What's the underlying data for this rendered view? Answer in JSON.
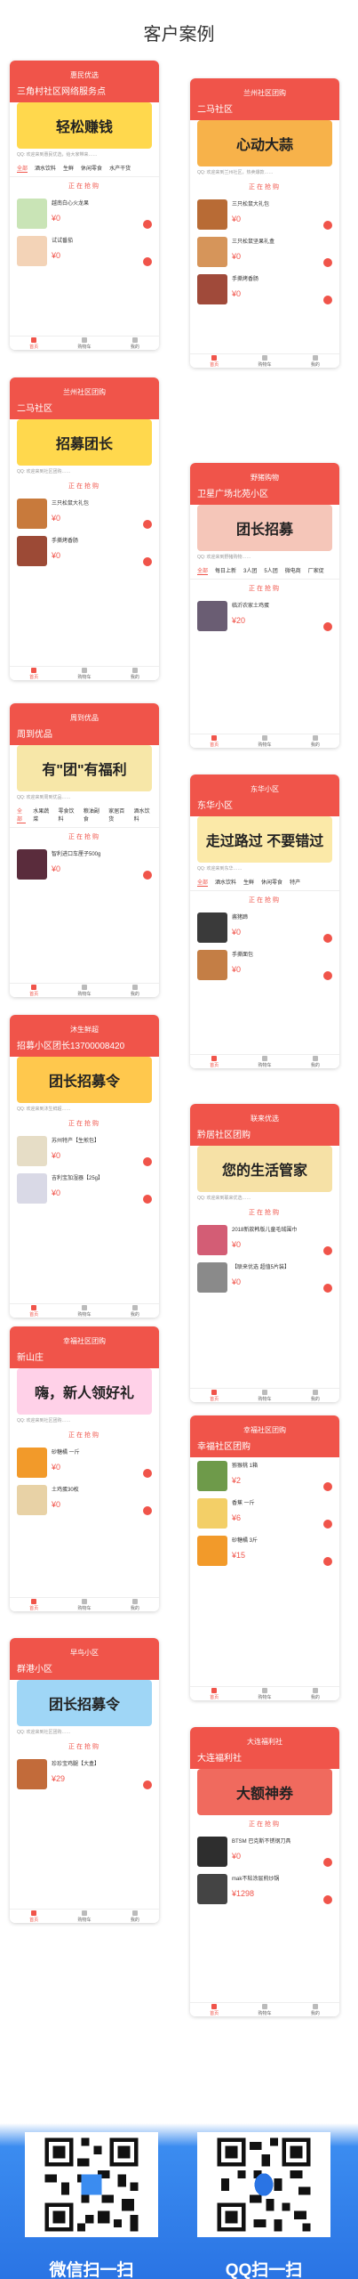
{
  "page": {
    "title": "客户案例"
  },
  "phones": [
    {
      "id": "p1",
      "header": "惠民优选",
      "location": "三角村社区网络服务点",
      "banner": "轻松赚钱",
      "bannerColor": "#ffd84d",
      "notice": "QQ: 欢迎来到惠民优选，给大家带来……",
      "tabs": [
        "全部",
        "酒水饮料",
        "生鲜",
        "休闲零食",
        "水产干货"
      ],
      "section": "正在抢购",
      "products": [
        {
          "name": "越南白心火龙果",
          "price": "¥0",
          "thumb": "#c9e4b6"
        },
        {
          "name": "试试番茄",
          "price": "¥0",
          "thumb": "#f3d3b7"
        }
      ],
      "nav": [
        "首页",
        "购物车",
        "我的"
      ]
    },
    {
      "id": "p2",
      "header": "兰州社区团购",
      "location": "二马社区",
      "banner": "心动大蒜",
      "bannerColor": "#f7b24a",
      "notice": "QQ: 欢迎来到兰州社区，热卖爆款……",
      "tabs": [],
      "section": "正在抢购",
      "products": [
        {
          "name": "三只松鼠大礼包",
          "price": "¥0",
          "thumb": "#b86b35"
        },
        {
          "name": "三只松鼠坚果礼盒",
          "price": "¥0",
          "thumb": "#d6955a"
        },
        {
          "name": "手撕烤香肠",
          "price": "¥0",
          "thumb": "#a04a3a"
        }
      ],
      "nav": [
        "首页",
        "购物车",
        "我的"
      ]
    },
    {
      "id": "p3",
      "header": "兰州社区团购",
      "location": "二马社区",
      "banner": "招募团长",
      "bannerColor": "#ffd84d",
      "notice": "QQ: 欢迎来到社区团购……",
      "tabs": [],
      "section": "正在抢购",
      "products": [
        {
          "name": "三只松鼠大礼包",
          "price": "¥0",
          "thumb": "#c87a3c"
        },
        {
          "name": "手撕烤香肠",
          "price": "¥0",
          "thumb": "#9c4a36"
        }
      ],
      "nav": [
        "首页",
        "购物车",
        "我的"
      ]
    },
    {
      "id": "p4",
      "header": "野猪购物",
      "location": "卫星广场北苑小区",
      "banner": "团长招募",
      "bannerColor": "#f5c6b9",
      "notice": "QQ: 欢迎来到野猪购物……",
      "tabs": [
        "全部",
        "每日上新",
        "3人团",
        "5人团",
        "微电商",
        "厂家促"
      ],
      "section": "正在抢购",
      "products": [
        {
          "name": "临沂农家土鸡蛋",
          "price": "¥20",
          "thumb": "#6a5d73"
        }
      ],
      "nav": [
        "首页",
        "购物车",
        "我的"
      ]
    },
    {
      "id": "p5",
      "header": "周到优品",
      "location": "周到优品",
      "banner": "有\"团\"有福利",
      "bannerColor": "#f7e7a8",
      "notice": "QQ: 欢迎来到周到优品……",
      "tabs": [
        "全部",
        "水果蔬菜",
        "零食饮料",
        "粮油副食",
        "家居百货",
        "酒水饮料"
      ],
      "section": "正在抢购",
      "products": [
        {
          "name": "智利进口车厘子500g",
          "price": "¥0",
          "thumb": "#5a2c3c"
        }
      ],
      "nav": [
        "首页",
        "购物车",
        "我的"
      ]
    },
    {
      "id": "p6",
      "header": "东华小区",
      "location": "东华小区",
      "banner": "走过路过 不要错过",
      "bannerColor": "#fbe9a8",
      "notice": "QQ: 欢迎来到东华……",
      "tabs": [
        "全部",
        "酒水饮料",
        "生鲜",
        "休闲零食",
        "特产"
      ],
      "section": "正在抢购",
      "products": [
        {
          "name": "酱猪蹄",
          "price": "¥0",
          "thumb": "#3a3a3a"
        },
        {
          "name": "手撕面包",
          "price": "¥0",
          "thumb": "#c47e45"
        }
      ],
      "nav": [
        "首页",
        "购物车",
        "我的"
      ]
    },
    {
      "id": "p7",
      "header": "沐生鲜超",
      "location": "招募小区团长13700008420",
      "banner": "团长招募令",
      "bannerColor": "#ffc84d",
      "notice": "QQ: 欢迎来到沐生鲜超……",
      "tabs": [],
      "section": "正在抢购",
      "products": [
        {
          "name": "苏州特产【生煎包】",
          "price": "¥0",
          "thumb": "#e6ddc6"
        },
        {
          "name": "吉利宝加湿器【25g】",
          "price": "¥0",
          "thumb": "#d9d9e6"
        }
      ],
      "nav": [
        "首页",
        "购物车",
        "我的"
      ]
    },
    {
      "id": "p8",
      "header": "联来优选",
      "location": "黔居社区团购",
      "banner": "您的生活管家",
      "bannerColor": "#f6e1a6",
      "notice": "QQ: 欢迎来到联来优选……",
      "tabs": [],
      "section": "正在抢购",
      "products": [
        {
          "name": "2018新款韩版儿童毛绒围巾",
          "price": "¥0",
          "thumb": "#d35d75"
        },
        {
          "name": "【联来优选 超值5片装】",
          "price": "¥0",
          "thumb": "#8a8a8a"
        }
      ],
      "nav": [
        "首页",
        "购物车",
        "我的"
      ]
    },
    {
      "id": "p9",
      "header": "幸福社区团购",
      "location": "新山庄",
      "banner": "嗨，新人领好礼",
      "bannerColor": "#ffd1e8",
      "notice": "QQ: 欢迎来到社区团购……",
      "tabs": [],
      "section": "正在抢购",
      "products": [
        {
          "name": "砂糖橘 一斤",
          "price": "¥0",
          "thumb": "#f29a2a"
        },
        {
          "name": "土鸡蛋30枚",
          "price": "¥0",
          "thumb": "#e8d2a6"
        }
      ],
      "nav": [
        "首页",
        "购物车",
        "我的"
      ]
    },
    {
      "id": "p10",
      "header": "幸福社区团购",
      "location": "幸福社区团购",
      "banner": "",
      "bannerColor": "#ffffff",
      "notice": "",
      "tabs": [],
      "section": "",
      "products": [
        {
          "name": "猕猴桃 1箱",
          "price": "¥2",
          "thumb": "#6e9a4a"
        },
        {
          "name": "香蕉 一斤",
          "price": "¥6",
          "thumb": "#f3cf67"
        },
        {
          "name": "砂糖橘 3斤",
          "price": "¥15",
          "thumb": "#f29a2a"
        }
      ],
      "nav": [
        "首页",
        "购物车",
        "我的"
      ]
    },
    {
      "id": "p11",
      "header": "早鸟小区",
      "location": "群港小区",
      "banner": "团长招募令",
      "bannerColor": "#9fd6f6",
      "notice": "QQ: 欢迎来到社区团购……",
      "tabs": [],
      "section": "正在抢购",
      "products": [
        {
          "name": "珍珍宝鸡腿【大盒】",
          "price": "¥29",
          "thumb": "#c26b3a"
        }
      ],
      "nav": [
        "首页",
        "购物车",
        "我的"
      ]
    },
    {
      "id": "p12",
      "header": "大连福利社",
      "location": "大连福利社",
      "banner": "大额神券",
      "bannerColor": "#f06a5e",
      "notice": "",
      "tabs": [],
      "section": "正在抢购",
      "products": [
        {
          "name": "BTSM 巴克斯不锈钢刀具",
          "price": "¥0",
          "thumb": "#2e2e2e"
        },
        {
          "name": "mak不粘涂层煎炒锅",
          "price": "¥1298",
          "thumb": "#444444"
        }
      ],
      "nav": [
        "首页",
        "购物车",
        "我的"
      ]
    }
  ],
  "qr": [
    {
      "label": "微信扫一扫"
    },
    {
      "label": "QQ扫一扫"
    }
  ]
}
